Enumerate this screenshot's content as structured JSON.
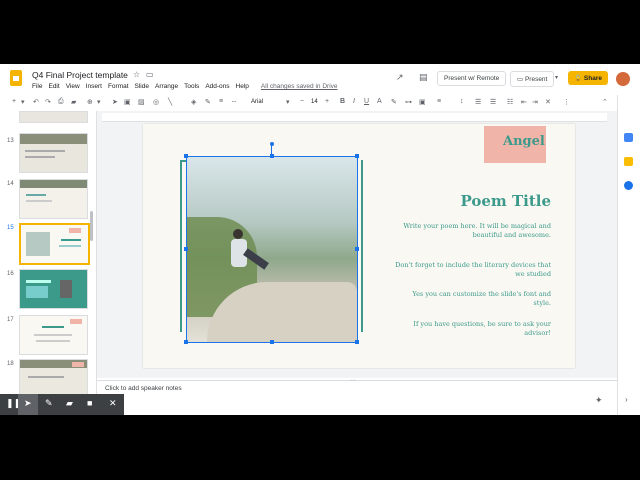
{
  "title_bar": {
    "doc_title": "Q4 Final Project template",
    "menu": [
      "File",
      "Edit",
      "View",
      "Insert",
      "Format",
      "Slide",
      "Arrange",
      "Tools",
      "Add-ons",
      "Help"
    ],
    "saved_status": "All changes saved in Drive",
    "present_remote_label": "Present w/ Remote",
    "present_label": "Present",
    "share_label": "Share"
  },
  "toolbar": {
    "font": "Arial",
    "font_size": "14"
  },
  "filmstrip": {
    "slides": [
      {
        "number": "13"
      },
      {
        "number": "14"
      },
      {
        "number": "15"
      },
      {
        "number": "16"
      },
      {
        "number": "17"
      },
      {
        "number": "18"
      }
    ],
    "selected": "15"
  },
  "slide": {
    "name_label": "Angel",
    "heading": "Poem Title",
    "paragraphs": [
      "Write your poem here. It will be magical and beautiful and awesome.",
      "Don't forget to include the literary devices that we studied",
      "Yes you can customize the slide's font and style.",
      "If you have questions, be sure to ask your advisor!"
    ]
  },
  "notes": {
    "placeholder": "Click to add speaker notes"
  },
  "colors": {
    "accent": "#3c9a8c",
    "name_box": "#f0b5a8",
    "share": "#f4b400",
    "selection": "#1a73e8"
  }
}
